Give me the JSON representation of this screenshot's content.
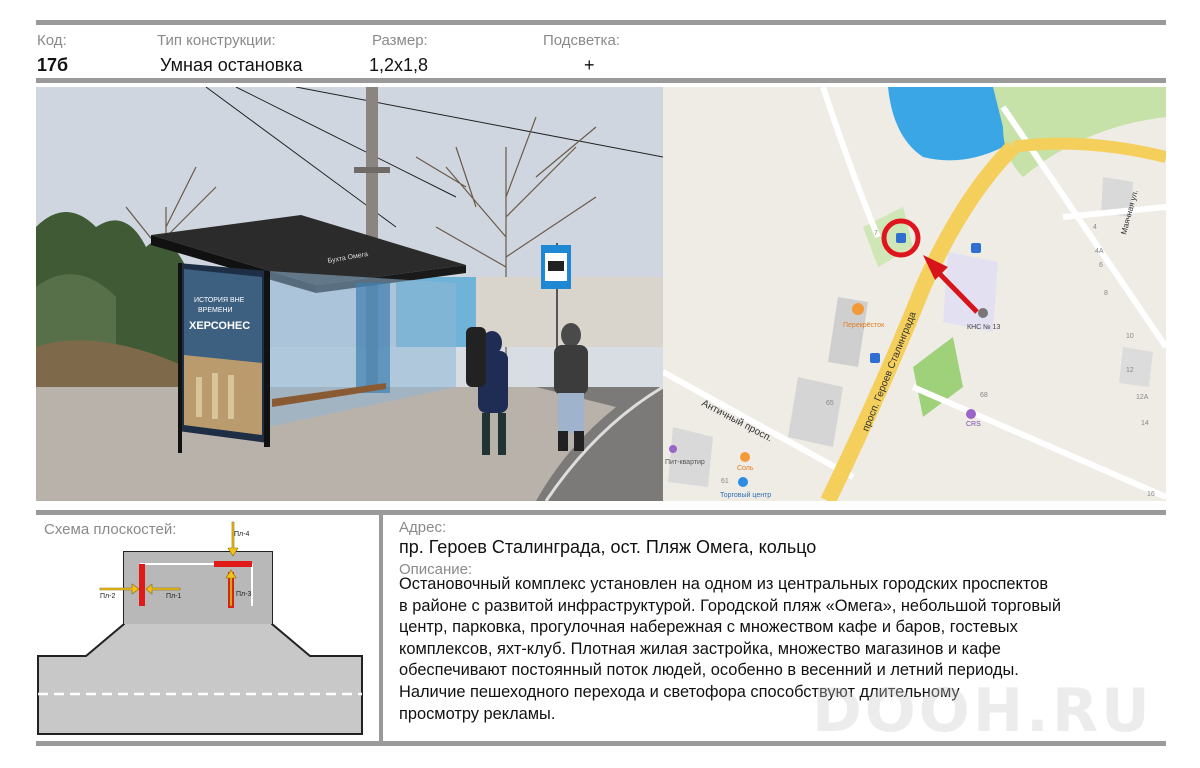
{
  "header": {
    "code_label": "Код:",
    "code_value": "17б",
    "type_label": "Тип конструкции:",
    "type_value": "Умная остановка",
    "size_label": "Размер:",
    "size_value": "1,2x1,8",
    "light_label": "Подсветка:",
    "light_value": "+"
  },
  "photo": {
    "shelter_sign": "Бухта Омега",
    "poster_line1": "ИСТОРИЯ ВНЕ",
    "poster_line2": "ВРЕМЕНИ",
    "poster_title": "ХЕРСОНЕС"
  },
  "map": {
    "street_main": "просп. Героев Сталинграда",
    "street_side": "Античный просп.",
    "street_right": "Маячная ул.",
    "poi_perekrestok": "Перекрёсток",
    "poi_kns": "КНС № 13",
    "poi_crs": "CRS",
    "poi_sol": "Соль",
    "poi_tc": "Торговый центр",
    "poi_kvartira": "Пит-квартир",
    "house_65": "65",
    "house_61": "61",
    "house_4": "4",
    "house_4a": "4А",
    "house_6": "6",
    "house_8": "8",
    "house_10": "10",
    "house_12": "12",
    "house_12a": "12А",
    "house_14": "14",
    "house_16": "16",
    "house_68": "68",
    "house_7": "7",
    "bus_icon": "bus-stop-icon",
    "marker_color": "#e0141d"
  },
  "schema": {
    "title": "Схема плоскостей:",
    "pl1": "Пл-1",
    "pl2": "Пл-2",
    "pl3": "Пл-3",
    "pl4": "Пл-4"
  },
  "address": {
    "label": "Адрес:",
    "value": "пр. Героев Сталинграда, ост. Пляж Омега, кольцо"
  },
  "description": {
    "label": "Описание:",
    "lines": [
      "Остановочный комплекс установлен на одном из центральных городских проспектов",
      "в районе с развитой инфраструктурой. Городской пляж «Омега», небольшой торговый",
      "центр, парковка, прогулочная набережная с множеством кафе и баров, гостевых",
      "комплексов, яхт-клуб. Плотная жилая застройка, множество магазинов и кафе",
      "обеспечивают постоянный поток людей, особенно в весенний и летний периоды.",
      "Наличие пешеходного перехода и светофора способствуют длительному",
      "просмотру рекламы."
    ]
  },
  "watermark": "DOOH.RU",
  "colors": {
    "rule": "#9a9a9a",
    "label": "#8a8a8a",
    "road_yellow": "#f5cf5b",
    "water": "#2aa3e0",
    "arrow_red": "#d7141c"
  }
}
